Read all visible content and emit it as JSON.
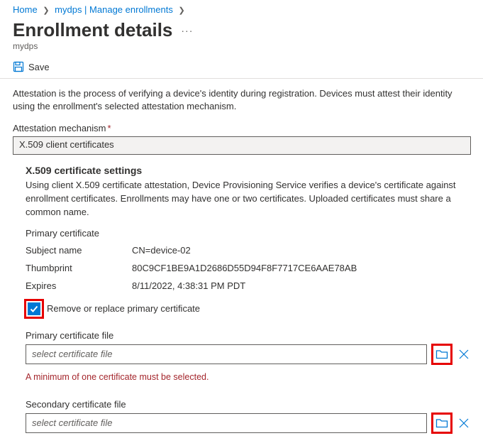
{
  "breadcrumb": {
    "home": "Home",
    "item1": "mydps | Manage enrollments"
  },
  "page": {
    "title": "Enrollment details",
    "subtitle": "mydps"
  },
  "toolbar": {
    "save_label": "Save"
  },
  "description": "Attestation is the process of verifying a device's identity during registration. Devices must attest their identity using the enrollment's selected attestation mechanism.",
  "attestation": {
    "label": "Attestation mechanism",
    "value": "X.509 client certificates"
  },
  "settings": {
    "heading": "X.509 certificate settings",
    "desc": "Using client X.509 certificate attestation, Device Provisioning Service verifies a device's certificate against enrollment certificates. Enrollments may have one or two certificates. Uploaded certificates must share a common name.",
    "primary_heading": "Primary certificate",
    "rows": {
      "subject_label": "Subject name",
      "subject_value": "CN=device-02",
      "thumb_label": "Thumbprint",
      "thumb_value": "80C9CF1BE9A1D2686D55D94F8F7717CE6AAE78AB",
      "expires_label": "Expires",
      "expires_value": "8/11/2022, 4:38:31 PM PDT"
    },
    "checkbox_label": "Remove or replace primary certificate",
    "primary_file_label": "Primary certificate file",
    "secondary_file_label": "Secondary certificate file",
    "file_placeholder": "select certificate file",
    "error": "A minimum of one certificate must be selected."
  }
}
